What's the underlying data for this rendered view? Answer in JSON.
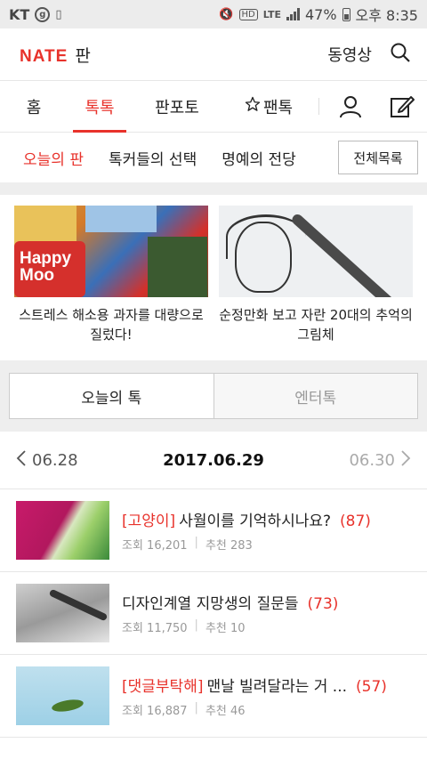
{
  "status": {
    "carrier": "KT",
    "network": "LTE",
    "battery": "47%",
    "time": "오후 8:35"
  },
  "header": {
    "logo": "NATE",
    "section": "판",
    "video_label": "동영상"
  },
  "tabs": [
    {
      "label": "홈"
    },
    {
      "label": "톡톡"
    },
    {
      "label": "판포토"
    },
    {
      "label": "팬톡"
    }
  ],
  "subtabs": {
    "items": [
      "오늘의 판",
      "톡커들의 선택",
      "명예의 전당"
    ],
    "all_button": "전체목록"
  },
  "featured": [
    {
      "title": "스트레스 해소용 과자를 대량으로 질렀다!",
      "image_text": "Happy Moo"
    },
    {
      "title": "순정만화 보고 자란 20대의 추억의 그림체"
    }
  ],
  "toggle": [
    "오늘의 톡",
    "엔터톡"
  ],
  "datenav": {
    "prev": "06.28",
    "current": "2017.06.29",
    "next": "06.30"
  },
  "list": [
    {
      "category": "[고양이]",
      "title": "사월이를 기억하시나요?",
      "count": "(87)",
      "views": "조회 16,201",
      "recommend": "추천 283"
    },
    {
      "category": "",
      "title": "디자인계열 지망생의 질문들",
      "count": "(73)",
      "views": "조회 11,750",
      "recommend": "추천 10"
    },
    {
      "category": "[댓글부탁해]",
      "title": "맨날 빌려달라는 거 ...",
      "count": "(57)",
      "views": "조회 16,887",
      "recommend": "추천 46"
    }
  ],
  "colors": {
    "accent": "#e8322b"
  }
}
